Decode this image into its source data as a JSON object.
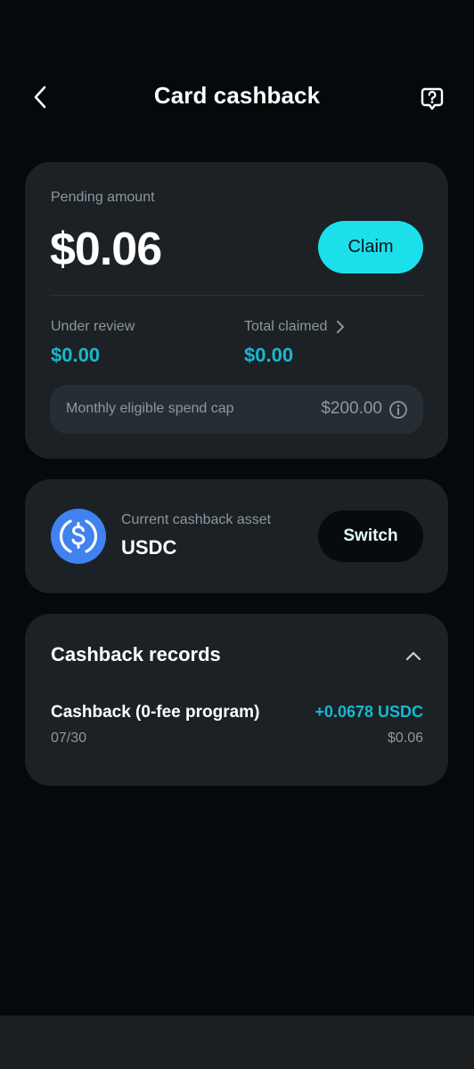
{
  "header": {
    "title": "Card cashback",
    "back_icon": "chevron-left-icon",
    "help_icon": "question-bubble-icon"
  },
  "pending": {
    "label": "Pending amount",
    "value": "$0.06",
    "claim_label": "Claim"
  },
  "stats": {
    "under_review_label": "Under review",
    "under_review_value": "$0.00",
    "total_claimed_label": "Total claimed",
    "total_claimed_value": "$0.00"
  },
  "spend_cap": {
    "label": "Monthly eligible spend cap",
    "value": "$200.00"
  },
  "asset": {
    "label": "Current cashback asset",
    "value": "USDC",
    "switch_label": "Switch"
  },
  "records": {
    "title": "Cashback records",
    "items": [
      {
        "name": "Cashback (0-fee program)",
        "date": "07/30",
        "amount": "+0.0678 USDC",
        "fiat": "$0.06"
      }
    ]
  },
  "colors": {
    "accent": "#1be0ec",
    "value_teal": "#18b8d0",
    "card_bg": "#1b2125",
    "page_bg": "#05090b",
    "usdc_blue": "#3f82f0"
  }
}
